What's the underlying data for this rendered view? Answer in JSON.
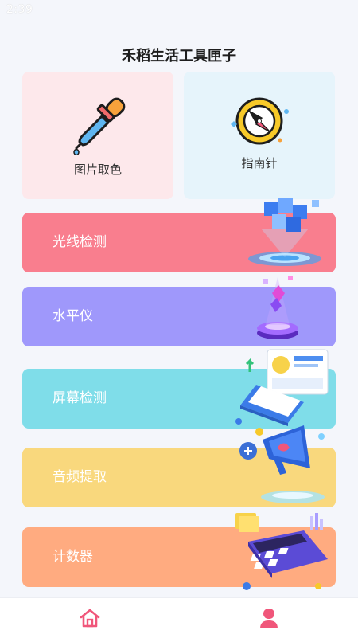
{
  "status_bar": {
    "time": "2:39"
  },
  "app_title": "禾稻生活工具匣子",
  "top_cards": [
    {
      "label": "图片取色",
      "icon": "eyedropper-icon",
      "bg": "#fde8eb"
    },
    {
      "label": "指南针",
      "icon": "compass-icon",
      "bg": "#e6f4fb"
    }
  ],
  "tools": [
    {
      "label": "光线检测",
      "color": "#f97e8e",
      "illustration": "cubes-hologram-illustration"
    },
    {
      "label": "水平仪",
      "color": "#9f98fb",
      "illustration": "crystal-pedestal-illustration"
    },
    {
      "label": "屏幕检测",
      "color": "#7fdde9",
      "illustration": "laptop-dashboard-illustration"
    },
    {
      "label": "音频提取",
      "color": "#f9d87d",
      "illustration": "megaphone-illustration"
    },
    {
      "label": "计数器",
      "color": "#ffab80",
      "illustration": "calculator-illustration"
    }
  ],
  "bottom_nav": [
    {
      "icon": "home-icon",
      "color": "#f0567a"
    },
    {
      "icon": "user-icon",
      "color": "#f0567a"
    }
  ]
}
